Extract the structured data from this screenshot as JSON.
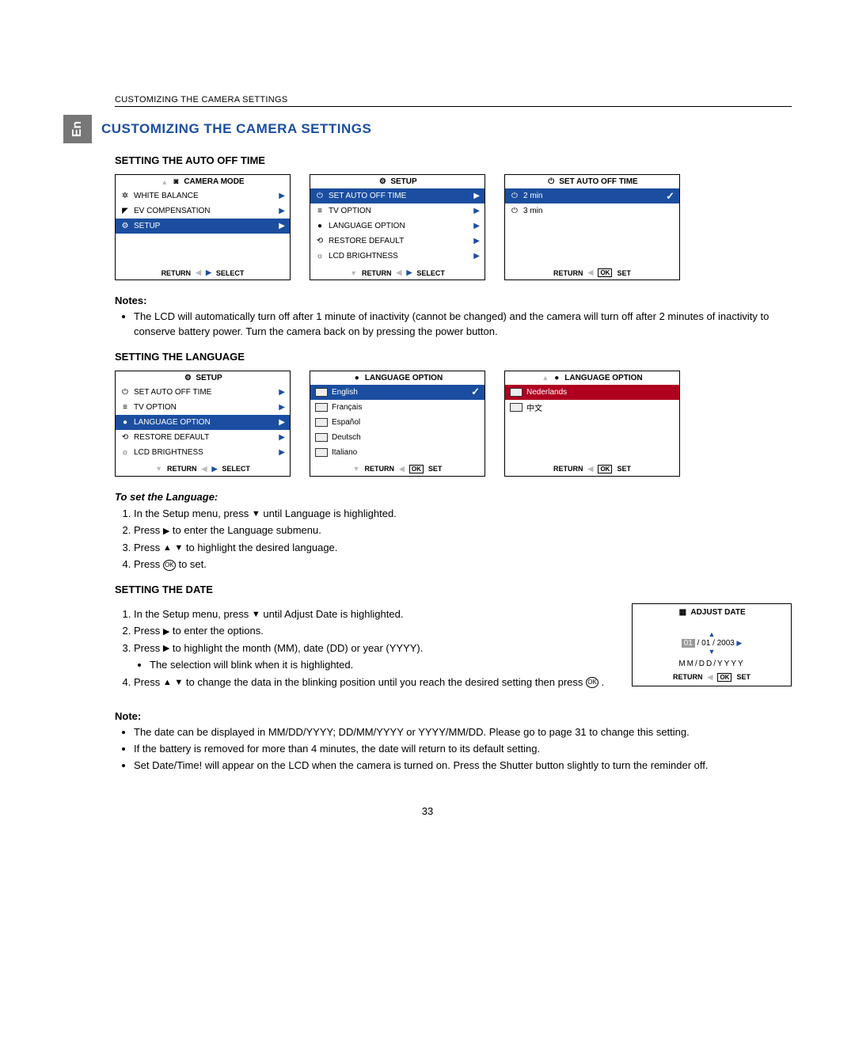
{
  "header": "CUSTOMIZING THE CAMERA SETTINGS",
  "lang_tab": "En",
  "section_title": "CUSTOMIZING THE CAMERA SETTINGS",
  "sub1": "SETTING THE AUTO OFF TIME",
  "screen1": {
    "title": "CAMERA MODE",
    "items": [
      "WHITE BALANCE",
      "EV COMPENSATION",
      "SETUP"
    ],
    "footer_left": "RETURN",
    "footer_right": "SELECT"
  },
  "screen2": {
    "title": "SETUP",
    "items": [
      "SET AUTO OFF TIME",
      "TV OPTION",
      "LANGUAGE OPTION",
      "RESTORE DEFAULT",
      "LCD BRIGHTNESS"
    ],
    "footer_left": "RETURN",
    "footer_right": "SELECT"
  },
  "screen3": {
    "title": "SET AUTO OFF TIME",
    "items": [
      "2 min",
      "3 min"
    ],
    "footer_left": "RETURN",
    "footer_right": "SET"
  },
  "notes1_title": "Notes:",
  "notes1": [
    "The LCD will automatically turn off after 1 minute of inactivity (cannot be changed) and the camera will turn off after 2 minutes of inactivity to conserve battery power. Turn the camera back on by pressing the power button."
  ],
  "sub2": "SETTING THE LANGUAGE",
  "screen4": {
    "title": "SETUP",
    "items": [
      "SET AUTO OFF TIME",
      "TV OPTION",
      "LANGUAGE OPTION",
      "RESTORE DEFAULT",
      "LCD BRIGHTNESS"
    ],
    "footer_left": "RETURN",
    "footer_right": "SELECT"
  },
  "screen5": {
    "title": "LANGUAGE  OPTION",
    "items": [
      "English",
      "Français",
      "Español",
      "Deutsch",
      "Italiano"
    ],
    "footer_left": "RETURN",
    "footer_right": "SET"
  },
  "screen6": {
    "title": "LANGUAGE  OPTION",
    "items": [
      "Nederlands",
      "中文"
    ],
    "footer_left": "RETURN",
    "footer_right": "SET"
  },
  "lang_steps_title": "To set the Language:",
  "lang_steps": [
    "In the Setup menu, press ▼ until Language is highlighted.",
    "Press ▶ to enter the Language submenu.",
    "Press ▲ ▼ to highlight the desired language.",
    "Press OK to set."
  ],
  "sub3": "SETTING THE DATE",
  "date_steps": [
    "In the Setup menu, press  ▼ until Adjust Date is highlighted.",
    "Press ▶ to enter the options.",
    "Press ▶ to highlight the month (MM), date (DD) or year (YYYY).",
    "Press ▲ ▼ to change the data in the blinking position until you reach the desired setting then press OK ."
  ],
  "date_substep": "The selection will blink when it is highlighted.",
  "date_screen": {
    "title": "ADJUST  DATE",
    "value_prefix": "01",
    "value_rest": " / 01 / 2003",
    "format": "MM/DD/YYYY",
    "footer_left": "RETURN",
    "footer_right": "SET"
  },
  "notes2_title": "Note:",
  "notes2": [
    "The date can be displayed in MM/DD/YYYY; DD/MM/YYYY or YYYY/MM/DD. Please go to page 31 to change this setting.",
    "If the battery is removed for more than 4 minutes, the date will return to its default setting.",
    "Set Date/Time! will appear on the LCD when the camera is turned on. Press the Shutter button slightly to turn the reminder off."
  ],
  "page_number": "33"
}
